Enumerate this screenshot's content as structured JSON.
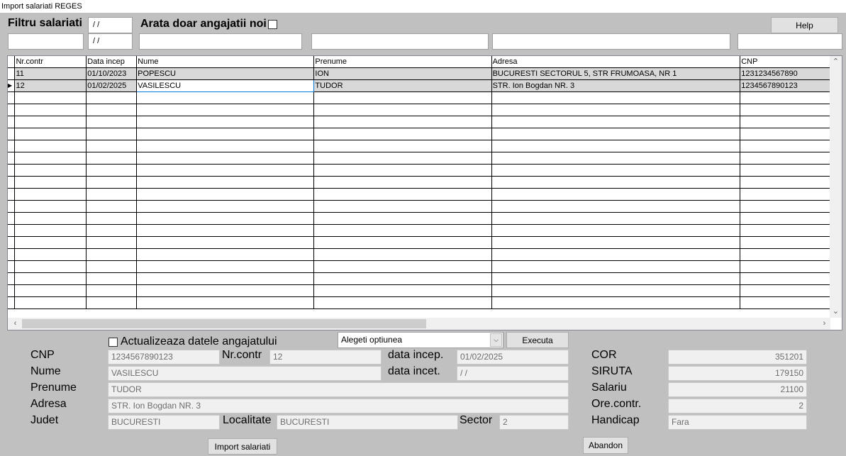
{
  "window": {
    "title": "Import salariati REGES"
  },
  "filter": {
    "label": "Filtru salariati",
    "date1": " / /",
    "date2": " / /",
    "new_only_label": "Arata doar angajatii noi",
    "help_label": "Help"
  },
  "grid": {
    "columns": [
      "Nr.contr",
      "Data incep",
      "Nume",
      "Prenume",
      "Adresa",
      "CNP"
    ],
    "rows": [
      {
        "nr": "11",
        "data": "01/10/2023",
        "nume": "POPESCU",
        "prenume": "ION",
        "adresa": "BUCURESTI SECTORUL 5, STR FRUMOASA, NR 1",
        "cnp": "1231234567890"
      },
      {
        "nr": "12",
        "data": "01/02/2025",
        "nume": "VASILESCU",
        "prenume": "TUDOR",
        "adresa": "STR. Ion Bogdan NR. 3",
        "cnp": "1234567890123"
      }
    ],
    "current_row_marker": "▶"
  },
  "actions": {
    "update_label": "Actualizeaza datele angajatului",
    "option_placeholder": "Alegeti optiunea",
    "execute_label": "Executa",
    "import_label": "Import salariati",
    "abandon_label": "Abandon"
  },
  "details": {
    "labels": {
      "cnp": "CNP",
      "nume": "Nume",
      "prenume": "Prenume",
      "adresa": "Adresa",
      "judet": "Judet",
      "nrcontr": "Nr.contr",
      "localitate": "Localitate",
      "sector": "Sector",
      "data_incep": "data incep.",
      "data_incet": "data incet.",
      "cor": "COR",
      "siruta": "SIRUTA",
      "salariu": "Salariu",
      "ore": "Ore.contr.",
      "handicap": "Handicap"
    },
    "values": {
      "cnp": "1234567890123",
      "nume": "VASILESCU",
      "prenume": "TUDOR",
      "adresa": "STR. Ion Bogdan NR. 3",
      "judet": "BUCURESTI",
      "nrcontr": "12",
      "localitate": "BUCURESTI",
      "sector": "2",
      "data_incep": "01/02/2025",
      "data_incet": " / /",
      "cor": "351201",
      "siruta": "179150",
      "salariu": "21100",
      "ore": "2",
      "handicap": "Fara"
    }
  }
}
